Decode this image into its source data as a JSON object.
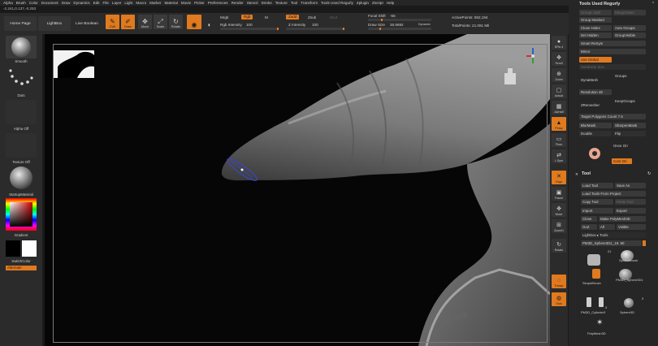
{
  "menu": [
    "Alpha",
    "Brush",
    "Color",
    "Document",
    "Draw",
    "Dynamics",
    "Edit",
    "File",
    "Layer",
    "Light",
    "Macro",
    "Marker",
    "Material",
    "Movie",
    "Picker",
    "Preferences",
    "Render",
    "Stencil",
    "Stroke",
    "Texture",
    "Tool",
    "Transform",
    "Tools Used Regurly",
    "Zplugin",
    "Zscript",
    "Help"
  ],
  "coords": "-2.241,0.137,-0.253",
  "toolbar": {
    "home": "Home Page",
    "lightbox": "LightBox",
    "live_boolean": "Live Boolean",
    "edit": "Edit",
    "draw": "Draw",
    "move": "Move",
    "scale": "Scale",
    "rotate": "Rotate",
    "mrgb": "Mrgb",
    "rgb": "Rgb",
    "m": "M",
    "rgb_intensity_label": "Rgb Intensity",
    "rgb_intensity_value": "100",
    "zadd": "Zadd",
    "zsub": "Zsub",
    "zcut": "Zcut",
    "z_intensity_label": "Z Intensity",
    "z_intensity_value": "100",
    "focal_label": "Focal Shift",
    "focal_value": "-55",
    "draw_size_label": "Draw Size",
    "draw_size_value": "26.8692",
    "dynamic": "Dynamic",
    "active_points": "ActivePoints: 592,194",
    "total_points": "TotalPoints: 21.081 Mil"
  },
  "left": {
    "smooth": "Smooth",
    "dots": "Dots",
    "alpha_off": "Alpha Off",
    "texture_off": "Texture Off",
    "startup_material": "StartupMaterial",
    "gradient": "Gradient",
    "switch_color": "SwitchColor",
    "alternate": "Alternate"
  },
  "right_icons": [
    "SPix 4",
    "Scroll",
    "Zoom",
    "Actual",
    "AAHalf",
    "Persp",
    "Floor",
    "L.Sym",
    "Gxyz",
    "Frame",
    "Move",
    "ZoomD",
    "Rotate",
    "Transp",
    "Solo"
  ],
  "panel": {
    "title": "Tools Used Regurly",
    "groups_split": "Groups Split",
    "merge_down": "MergeDown",
    "group_masked": "Group Masked",
    "close_holes": "Close Holes",
    "auto_groups": "Auto Groups",
    "del_hidden": "Del Hidden",
    "group_visible": "GroupVisible",
    "smart_resym": "Smart ReSym",
    "mirror": "Mirror",
    "use_global": "Use Global",
    "subdivide_size": "Subdivide Size",
    "dynamesh": "DynaMesh",
    "groups": "Groups",
    "resolution_label": "Resolution",
    "resolution_value": "48",
    "zremesher": "ZRemesher",
    "keep_groups": "KeepGroups",
    "target_label": "Target Polygons Count",
    "target_value": "7.5",
    "blur_mask": "BlurMask",
    "sharpen_mask": "SharpenMask",
    "double": "Double",
    "flip": "Flip",
    "once_ori": "Once Ori",
    "core_ori": "Core Ori",
    "tool_title": "Tool",
    "load_tool": "Load Tool",
    "save_as": "Save As",
    "load_tools_project": "Load Tools From Project",
    "copy_tool": "Copy Tool",
    "paste_tool": "Paste Tool",
    "import": "Import",
    "export": "Export",
    "clone": "Clone",
    "make_polymesh": "Make PolyMesh3D",
    "goz": "GoZ",
    "all": "All",
    "visible": "Visible",
    "lightbox_tools": "Lightbox ▸ Tools",
    "current_tool": "PM3D_Sphere3D1_19. 50",
    "thumbs": [
      "SphereBrush",
      "SimpleBrush",
      "PM3D_Sphere3D1",
      "PM3D_Cylinder3",
      "PM3D_Cylinder3",
      "Sphere3D",
      "PolyMesh3D"
    ],
    "count_a": "21",
    "count_b": "3",
    "count_c": "3"
  }
}
